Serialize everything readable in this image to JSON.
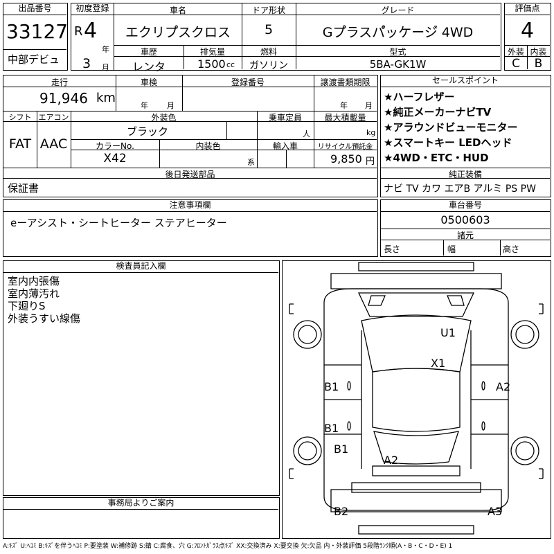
{
  "header": {
    "lot_label": "出品番号",
    "lot_number": "33127",
    "debut": "中部デビュ",
    "first_reg_label": "初度登録",
    "era": "R",
    "year_value": "4",
    "year_unit": "年",
    "month_value": "3",
    "month_unit": "月",
    "car_name_label": "車名",
    "car_name": "エクリプ゚スクロス",
    "door_label": "ドア形状",
    "door_value": "5",
    "grade_label": "グレード",
    "grade_value": "Gプ゚ラスパ゚ッケージ゙ 4WD",
    "score_label": "評価点",
    "score_value": "4",
    "history_label": "車歴",
    "history_value": "レンタ",
    "displacement_label": "排気量",
    "displacement_value": "1500",
    "displacement_unit": "cc",
    "fuel_label": "燃料",
    "fuel_value": "ガソリン",
    "model_label": "型式",
    "model_value": "5BA-GK1W",
    "exterior_label": "外装",
    "exterior_grade": "C",
    "interior_label": "内装",
    "interior_grade": "B"
  },
  "details": {
    "mileage_label": "走行",
    "mileage_value": "91,946",
    "mileage_unit": "km",
    "inspection_label": "車検",
    "year_unit": "年",
    "month_unit": "月",
    "reg_no_label": "登録番号",
    "transfer_label": "譲渡書類期限",
    "shift_label": "シフト",
    "shift_value": "FAT",
    "ac_label": "エアコン",
    "ac_value": "AAC",
    "ext_color_label": "外装色",
    "ext_color_value": "ブラック",
    "capacity_label": "乗車定員",
    "capacity_unit": "人",
    "max_load_label": "最大積載量",
    "max_load_unit": "kg",
    "color_no_label": "カラーNo.",
    "color_no_value": "X42",
    "int_color_label": "内装色",
    "int_color_unit": "系",
    "import_label": "輸入車",
    "recycle_label": "リサイクル預託金",
    "recycle_value": "9,850",
    "recycle_unit": "円",
    "later_parts_label": "後日発送部品",
    "later_parts_value": "保証書"
  },
  "sales_points": {
    "label": "セールスポイント",
    "items": [
      "★ハーフレザー",
      "★純正メーカーナビTV",
      "★アラウンドビューモニター",
      "★スマートキー LEDヘッド",
      "★4WD・ETC・HUD"
    ]
  },
  "equipment": {
    "label": "純正装備",
    "value": "ナビ TV カワ エアB アルミ PS PW"
  },
  "notes": {
    "label": "注意事項欄",
    "value": "eーアシスト・シートヒーター ステアヒーター"
  },
  "chassis": {
    "label": "車台番号",
    "value": "0500603",
    "spec_label": "諸元",
    "length_label": "長さ",
    "width_label": "幅",
    "height_label": "高さ"
  },
  "inspector": {
    "label": "検査員記入欄",
    "lines": [
      "室内内張傷",
      "室内薄汚れ",
      "下廻りS",
      "外装うすい線傷"
    ]
  },
  "office": {
    "label": "事務局よりご案内"
  },
  "diagram": {
    "marks": [
      {
        "text": "U1"
      },
      {
        "text": "X1"
      },
      {
        "text": "B1"
      },
      {
        "text": "A2"
      },
      {
        "text": "B1"
      },
      {
        "text": "B1"
      },
      {
        "text": "A2"
      },
      {
        "text": "B2"
      },
      {
        "text": "A3"
      }
    ]
  },
  "footer": "A:ｷｽﾞ U:ﾍｺﾐ B:ｷｽﾞを伴うﾍｺﾐ P:要塗装 W:補修跡 S:錆 C:腐食、穴 G:ﾌﾛﾝﾄｶﾞﾗｽ点ｷｽﾞ XX:交換済み X:要交換 欠:欠品 内・外装評価 5段階ﾗﾝｸ順(A・B・C・D・E) 1"
}
